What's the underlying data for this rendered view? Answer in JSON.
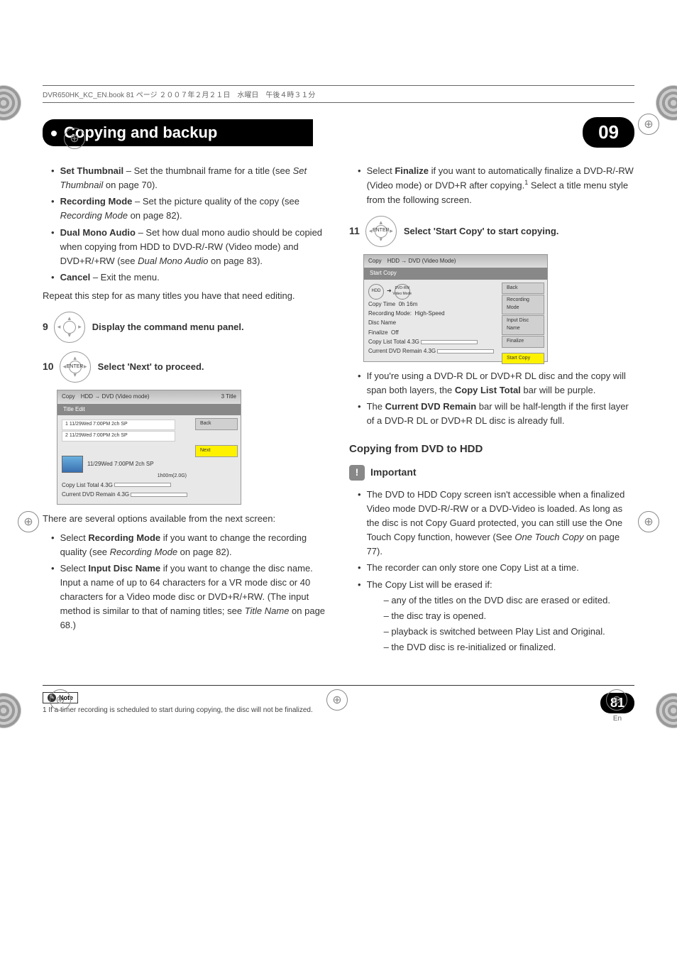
{
  "header_line": "DVR650HK_KC_EN.book  81 ページ  ２００７年２月２１日　水曜日　午後４時３１分",
  "chapter": {
    "title": "Copying and backup",
    "number": "09"
  },
  "left_col": {
    "b1_label": "Set Thumbnail",
    "b1_text": " – Set the thumbnail frame for a title (see ",
    "b1_ref": "Set Thumbnail",
    "b1_tail": " on page 70).",
    "b2_label": "Recording Mode",
    "b2_text": " – Set the picture quality of the copy (see ",
    "b2_ref": "Recording Mode",
    "b2_tail": " on page 82).",
    "b3_label": "Dual Mono Audio",
    "b3_text": " – Set how dual mono audio should be copied when copying from HDD to DVD-R/-RW (Video mode) and DVD+R/+RW (see ",
    "b3_ref": "Dual Mono Audio",
    "b3_tail": " on page 83).",
    "b4_label": "Cancel",
    "b4_text": " – Exit the menu.",
    "repeat": "Repeat this step for as many titles you have that need editing.",
    "step9": {
      "num": "9",
      "text": "Display the command menu panel."
    },
    "step10": {
      "num": "10",
      "btn": "ENTER",
      "text": "Select 'Next' to proceed."
    },
    "ss1": {
      "copy": "Copy",
      "mode": "HDD → DVD (Video mode)",
      "titles": "3  Title",
      "tab": "Title Edit",
      "row1": "1     11/29Wed  7:00PM   2ch   SP",
      "row2": "2     11/29Wed  7:00PM   2ch   SP",
      "back": "Back",
      "next": "Next",
      "previewline": "11/29Wed  7:00PM   2ch   SP",
      "duration": "1h00m(2.0G)",
      "total": "Copy List Total",
      "remain": "Current DVD Remain",
      "g1": "4.3G",
      "g2": "4.3G"
    },
    "options_intro": "There are several options available from the next screen:",
    "opt1_pre": "Select ",
    "opt1_label": "Recording Mode",
    "opt1_text": " if you want to change the recording quality (see ",
    "opt1_ref": "Recording Mode",
    "opt1_tail": " on page 82).",
    "opt2_pre": "Select ",
    "opt2_label": "Input Disc Name",
    "opt2_text": " if you want to change the disc name. Input a name of up to 64 characters for a VR mode disc or 40 characters for a Video mode disc or DVD+R/+RW. (The input method is similar to that of naming titles; see ",
    "opt2_ref": "Title Name",
    "opt2_tail": " on page 68.)"
  },
  "right_col": {
    "fin_pre": "Select ",
    "fin_label": "Finalize",
    "fin_text1": " if you want to automatically finalize a DVD-R/-RW (Video mode) or DVD+R after copying.",
    "sup": "1",
    "fin_text2": " Select a title menu style from the following screen.",
    "step11": {
      "num": "11",
      "btn": "ENTER",
      "text": "Select 'Start Copy' to start copying."
    },
    "ss2": {
      "copy": "Copy",
      "mode": "HDD → DVD (Video Mode)",
      "tab": "Start Copy",
      "hdd": "HDD",
      "dest": "DVD-RW\nVideo Mode",
      "time_label": "Copy Time",
      "time_val": "0h 16m",
      "rec_label": "Recording Mode:",
      "rec_val": "High-Speed",
      "discname": "Disc Name",
      "fin_label": "Finalize",
      "fin_val": "Off",
      "total": "Copy List Total",
      "remain": "Current DVD Remain",
      "g1": "4.3G",
      "g2": "4.3G",
      "m_back": "Back",
      "m_rec": "Recording Mode",
      "m_input": "Input Disc Name",
      "m_finalize": "Finalize",
      "m_start": "Start Copy"
    },
    "after1_pre": "If you're using a DVD-R DL or DVD+R DL disc and the copy will span both layers, the ",
    "after1_label": "Copy List Total",
    "after1_tail": " bar will be purple.",
    "after2_pre": "The ",
    "after2_label": "Current DVD Remain",
    "after2_tail": " bar will be half-length if the first layer of a DVD-R DL or DVD+R DL disc is already full.",
    "section": "Copying from DVD to HDD",
    "important": "Important",
    "imp1a": "The DVD to HDD Copy screen isn't accessible when a finalized Video mode DVD-R/-RW or a DVD-Video is loaded. As long as the disc is not Copy Guard protected, you can still use the One Touch Copy function, however (See ",
    "imp1_ref": "One Touch Copy",
    "imp1b": " on page 77).",
    "imp2": "The recorder can only store one Copy List at a time.",
    "imp3": "The Copy List will be erased if:",
    "imp3a": "– any of the titles on the DVD disc are erased or edited.",
    "imp3b": "– the disc tray is opened.",
    "imp3c": "– playback is switched between Play List and Original.",
    "imp3d": "– the DVD disc is re-initialized or finalized."
  },
  "footer": {
    "note": "Note",
    "footnote": "1 If a timer recording is scheduled to start during copying, the disc will not be finalized.",
    "page": "81",
    "lang": "En"
  }
}
